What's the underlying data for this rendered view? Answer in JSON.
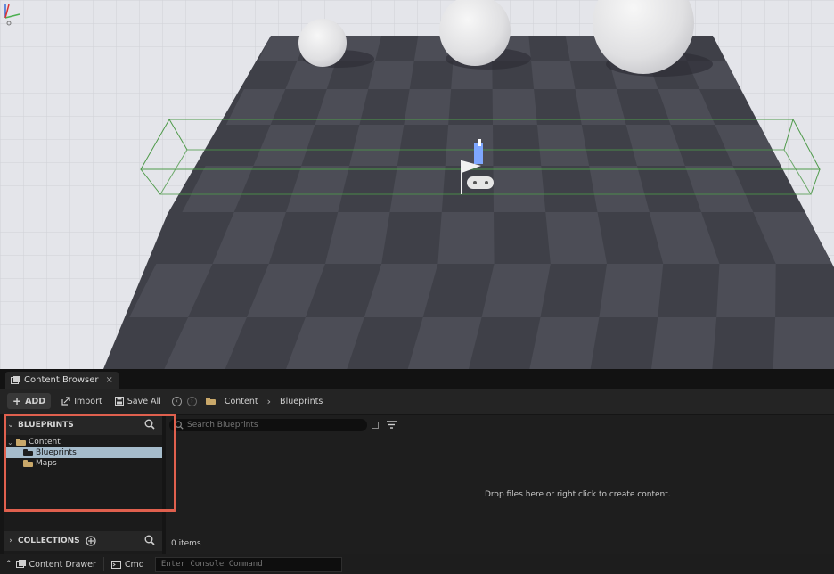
{
  "tab": {
    "title": "Content Browser",
    "close": "×"
  },
  "toolbar": {
    "add_label": "ADD",
    "import_label": "Import",
    "saveall_label": "Save All",
    "breadcrumb": [
      "Content",
      "Blueprints"
    ],
    "breadcrumb_sep": "›"
  },
  "left_panel": {
    "blueprints_header": "BLUEPRINTS",
    "tree": [
      {
        "label": "Content",
        "expanded": true,
        "selected": false
      },
      {
        "label": "Blueprints",
        "selected": true
      },
      {
        "label": "Maps",
        "selected": false
      }
    ],
    "collections_header": "COLLECTIONS"
  },
  "content": {
    "search_placeholder": "Search Blueprints",
    "empty_message": "Drop files here or right click to create content.",
    "item_count": "0 items"
  },
  "statusbar": {
    "drawer_label": "Content Drawer",
    "cmd_label": "Cmd",
    "console_placeholder": "Enter Console Command"
  },
  "colors": {
    "accent_highlight": "#e0604e",
    "selected_row": "#a6bccc",
    "folder": "#c9a86a"
  }
}
